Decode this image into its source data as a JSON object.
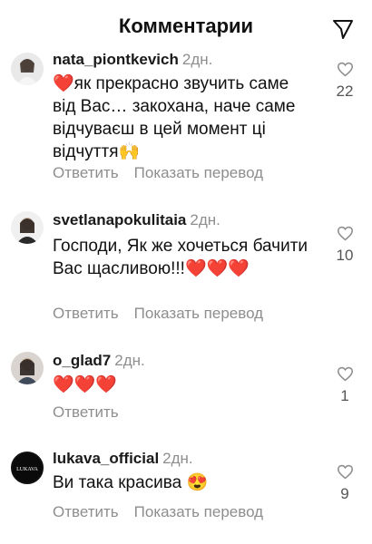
{
  "header": {
    "title": "Комментарии"
  },
  "comments": [
    {
      "username": "nata_piontkevich",
      "time": "2дн.",
      "text": "❤️як прекрасно звучить саме від Вас… закохана, наче саме відчуваєш в цей момент ці відчуття🙌",
      "reply_label": "Ответить",
      "translate_label": "Показать перевод",
      "likes": "22"
    },
    {
      "username": "svetlanapokulitaia",
      "time": "2дн.",
      "text": "Господи, Як же хочеться бачити Вас щасливою!!!❤️❤️❤️",
      "reply_label": "Ответить",
      "translate_label": "Показать перевод",
      "likes": "10"
    },
    {
      "username": "o_glad7",
      "time": "2дн.",
      "text": "❤️❤️❤️",
      "reply_label": "Ответить",
      "likes": "1"
    },
    {
      "username": "lukava_official",
      "time": "2дн.",
      "text": "Ви така красива 😍",
      "reply_label": "Ответить",
      "translate_label": "Показать перевод",
      "likes": "9",
      "avatar_text": "LUKAVA"
    }
  ],
  "colors": {
    "muted": "#8e8e8e",
    "heart": "#e0163a"
  },
  "icons": {
    "send": "send-icon",
    "like": "heart-outline-icon"
  }
}
